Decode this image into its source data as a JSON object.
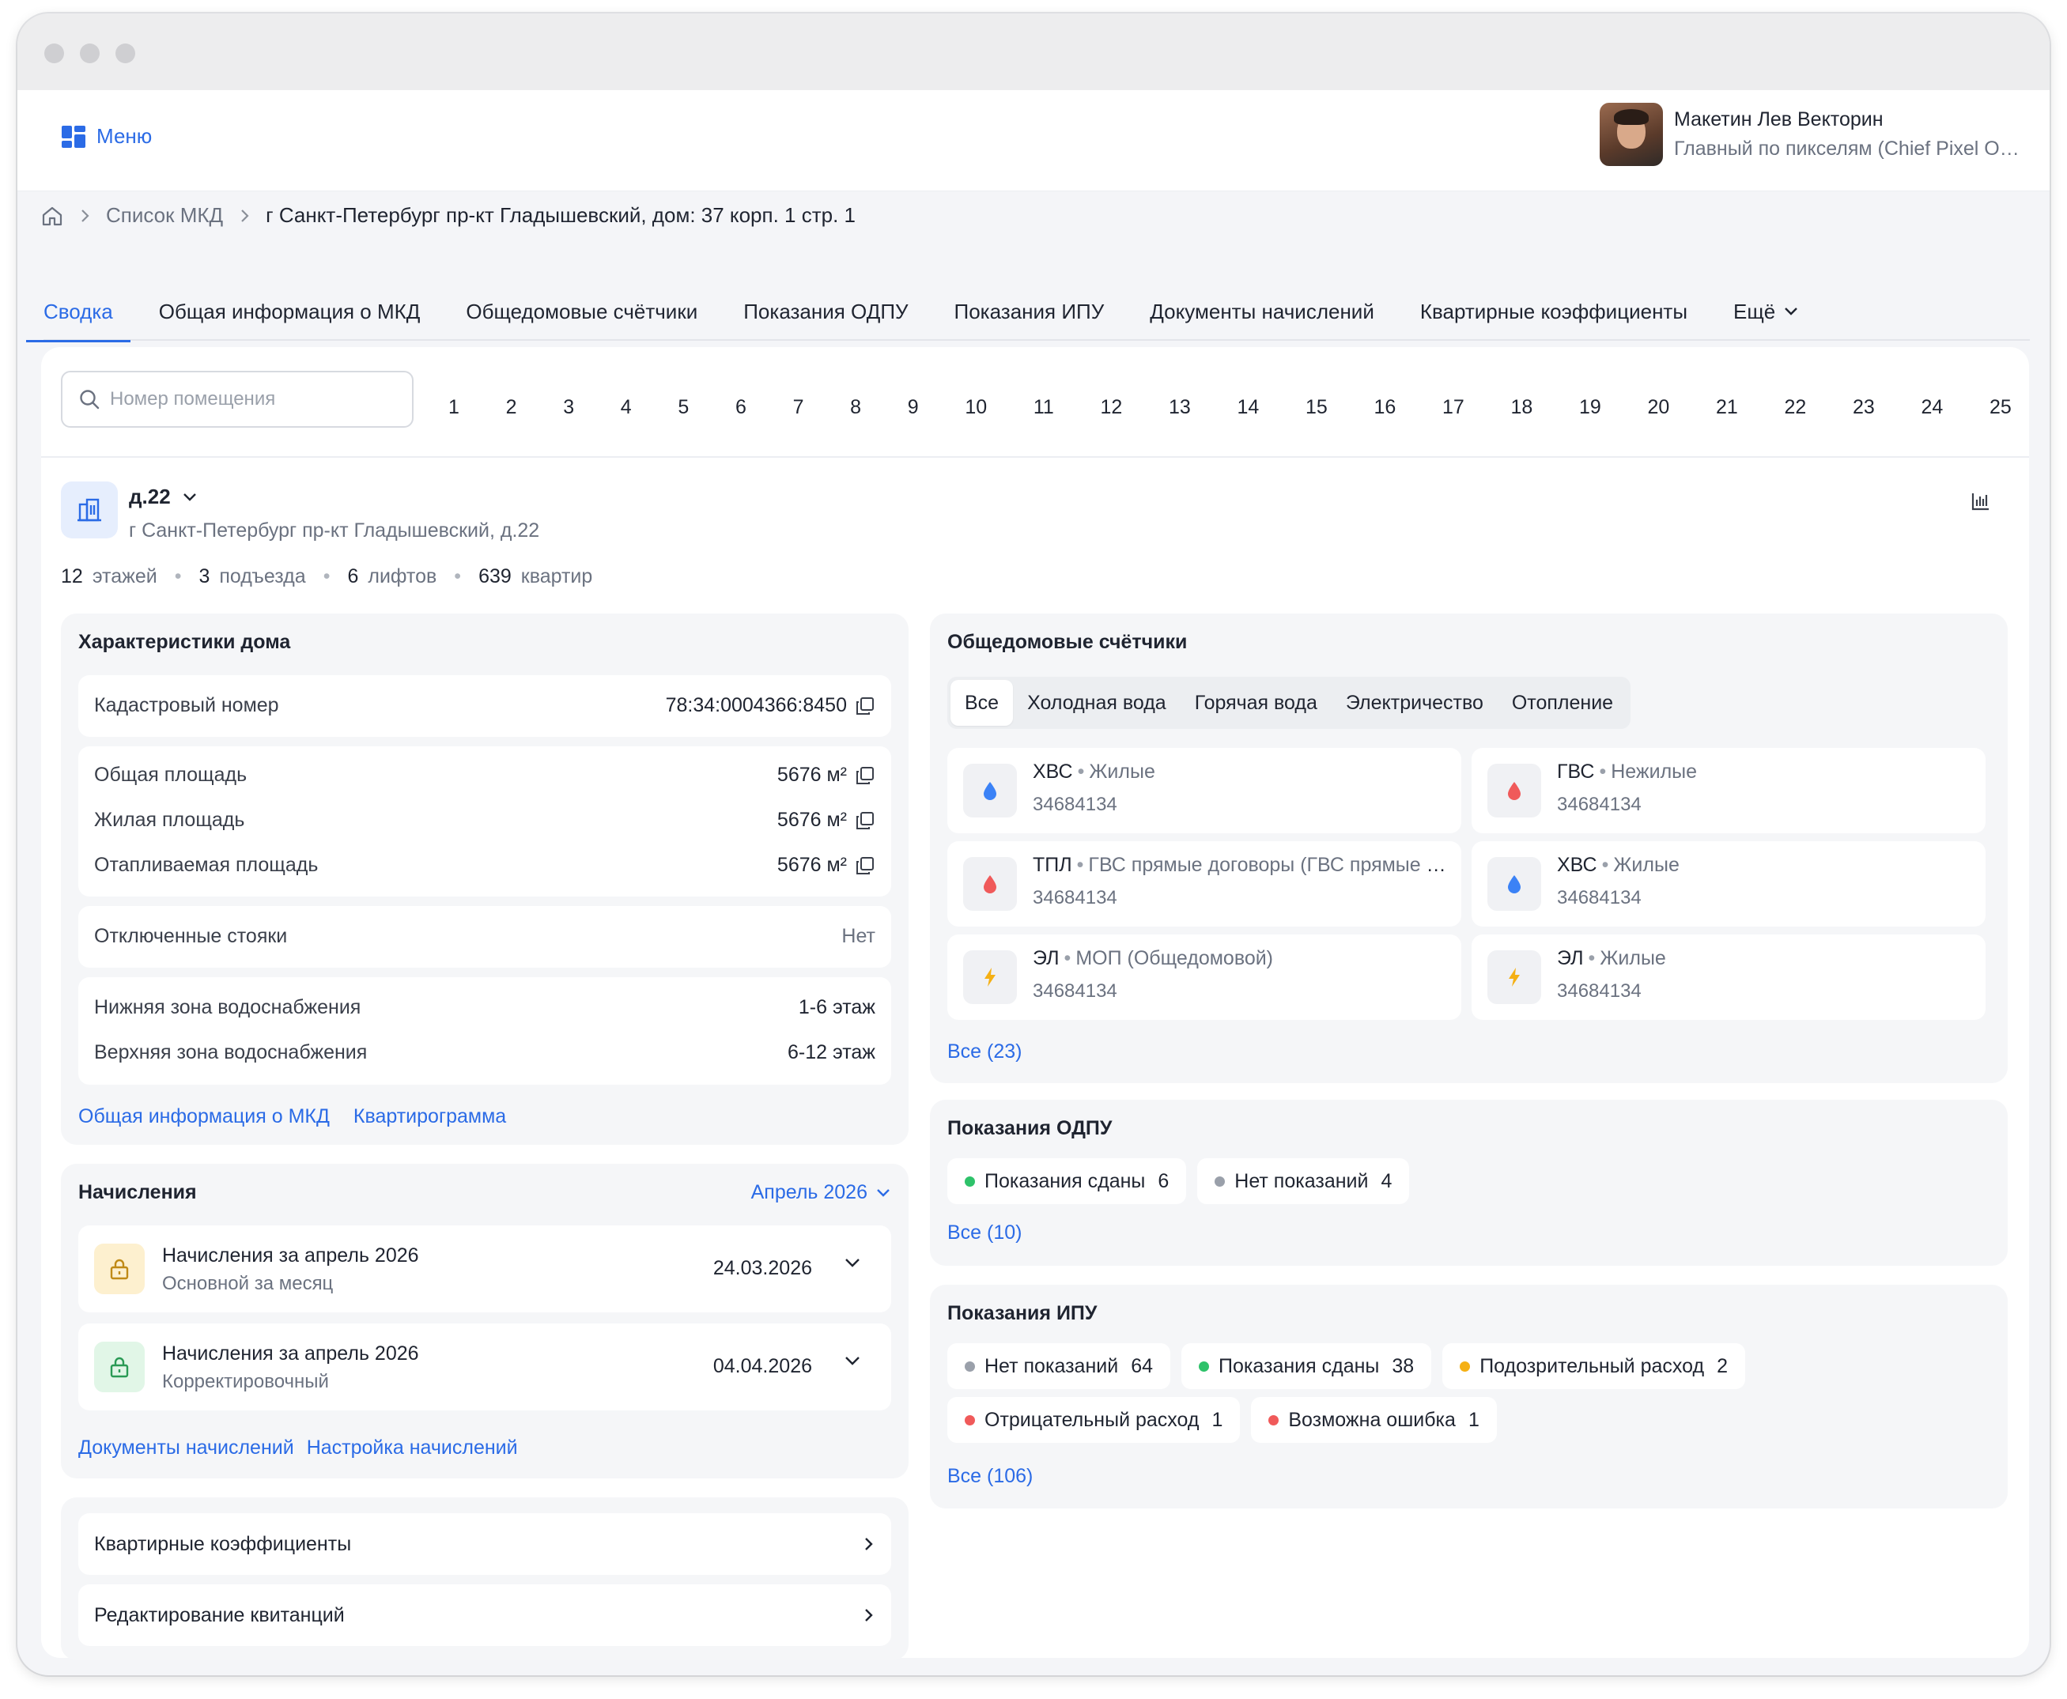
{
  "header": {
    "menu_label": "Меню",
    "user": {
      "name": "Макетин Лев Векторин",
      "role": "Главный по пикселям (Chief Pixel Officer)"
    }
  },
  "breadcrumb": {
    "item1": "Список МКД",
    "current": "г Санкт-Петербург пр-кт Гладышевский, дом: 37 корп. 1 стр. 1"
  },
  "tabs": [
    "Сводка",
    "Общая информация о МКД",
    "Общедомовые счётчики",
    "Показания ОДПУ",
    "Показания ИПУ",
    "Документы начислений",
    "Квартирные коэффициенты",
    "Ещё"
  ],
  "search": {
    "placeholder": "Номер помещения"
  },
  "pages": [
    "1",
    "2",
    "3",
    "4",
    "5",
    "6",
    "7",
    "8",
    "9",
    "10",
    "11",
    "12",
    "13",
    "14",
    "15",
    "16",
    "17",
    "18",
    "19",
    "20",
    "21",
    "22",
    "23",
    "24",
    "25"
  ],
  "house": {
    "title": "д.22",
    "address": "г Санкт-Петербург пр-кт Гладышевский, д.22",
    "stats": [
      {
        "value": "12",
        "label": "этажей"
      },
      {
        "value": "3",
        "label": "подъезда"
      },
      {
        "value": "6",
        "label": "лифтов"
      },
      {
        "value": "639",
        "label": "квартир"
      }
    ]
  },
  "characteristics": {
    "title": "Характеристики дома",
    "cadastral": {
      "label": "Кадастровый номер",
      "value": "78:34:0004366:8450"
    },
    "total_area": {
      "label": "Общая площадь",
      "value": "5676 м²"
    },
    "living_area": {
      "label": "Жилая площадь",
      "value": "5676 м²"
    },
    "heated_area": {
      "label": "Отапливаемая площадь",
      "value": "5676 м²"
    },
    "risers": {
      "label": "Отключенные стояки",
      "value": "Нет"
    },
    "lower_zone": {
      "label": "Нижняя зона водоснабжения",
      "value": "1-6 этаж"
    },
    "upper_zone": {
      "label": "Верхняя зона водоснабжения",
      "value": "6-12 этаж"
    },
    "links": [
      "Общая информация о МКД",
      "Квартирограмма"
    ]
  },
  "charges": {
    "title": "Начисления",
    "period": "Апрель 2026",
    "items": [
      {
        "title": "Начисления за апрель 2026",
        "subtitle": "Основной за месяц",
        "date": "24.03.2026"
      },
      {
        "title": "Начисления за апрель 2026",
        "subtitle": "Корректировочный",
        "date": "04.04.2026"
      }
    ],
    "links": [
      "Документы начислений",
      "Настройка начислений"
    ]
  },
  "nav_rows": [
    "Квартирные коэффициенты",
    "Редактирование квитанций"
  ],
  "meters": {
    "title": "Общедомовые счётчики",
    "tabs": [
      "Все",
      "Холодная вода",
      "Горячая вода",
      "Электричество",
      "Отопление"
    ],
    "items": [
      {
        "type": "ХВС",
        "kind": "Жилые",
        "number": "34684134",
        "icon": "water-cold-icon"
      },
      {
        "type": "ГВС",
        "kind": "Нежилые",
        "number": "34684134",
        "icon": "water-hot-icon"
      },
      {
        "type": "ТПЛ",
        "kind": "ГВС прямые договоры (ГВС прямые договоры)",
        "number": "34684134",
        "icon": "heating-icon"
      },
      {
        "type": "ХВС",
        "kind": "Жилые",
        "number": "34684134",
        "icon": "water-cold-icon"
      },
      {
        "type": "ЭЛ",
        "kind": "МОП (Общедомовой)",
        "number": "34684134",
        "icon": "electricity-icon"
      },
      {
        "type": "ЭЛ",
        "kind": "Жилые",
        "number": "34684134",
        "icon": "electricity-icon"
      }
    ],
    "all_link": "Все (23)"
  },
  "odpu": {
    "title": "Показания ОДПУ",
    "chips": [
      {
        "label": "Показания сданы",
        "count": "6",
        "color": "#2ec26a"
      },
      {
        "label": "Нет показаний",
        "count": "4",
        "color": "#9aa0aa"
      }
    ],
    "all_link": "Все (10)"
  },
  "ipu": {
    "title": "Показания ИПУ",
    "chips_row1": [
      {
        "label": "Нет показаний",
        "count": "64",
        "color": "#9aa0aa"
      },
      {
        "label": "Показания сданы",
        "count": "38",
        "color": "#2ec26a"
      },
      {
        "label": "Подозрительный расход",
        "count": "2",
        "color": "#f5b014"
      }
    ],
    "chips_row2": [
      {
        "label": "Отрицательный расход",
        "count": "1",
        "color": "#f05a5a"
      },
      {
        "label": "Возможна ошибка",
        "count": "1",
        "color": "#f05a5a"
      }
    ],
    "all_link": "Все (106)"
  },
  "colors": {
    "accent": "#2b6be6",
    "water_cold": "#3b82f6",
    "water_hot": "#f05a5a",
    "electricity": "#f5b014",
    "lock_yellow_bg": "#fdf0cf",
    "lock_green_bg": "#e1f6e7"
  }
}
